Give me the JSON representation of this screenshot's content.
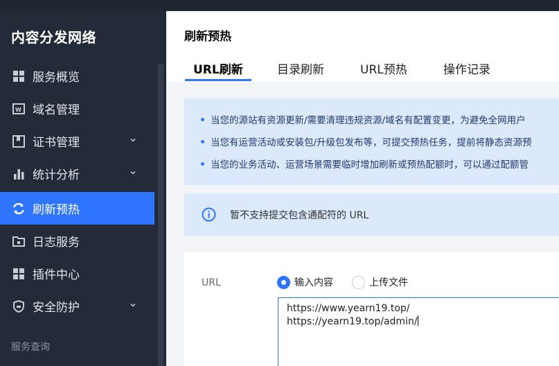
{
  "sidebar": {
    "title": "内容分发网络",
    "items": [
      {
        "label": "服务概览",
        "icon": "grid-icon",
        "expandable": false,
        "active": false
      },
      {
        "label": "域名管理",
        "icon": "domain-icon",
        "expandable": false,
        "active": false
      },
      {
        "label": "证书管理",
        "icon": "certificate-icon",
        "expandable": true,
        "active": false
      },
      {
        "label": "统计分析",
        "icon": "bar-chart-icon",
        "expandable": true,
        "active": false
      },
      {
        "label": "刷新预热",
        "icon": "refresh-icon",
        "expandable": false,
        "active": true
      },
      {
        "label": "日志服务",
        "icon": "folder-icon",
        "expandable": false,
        "active": false
      },
      {
        "label": "插件中心",
        "icon": "grid-icon",
        "expandable": false,
        "active": false
      },
      {
        "label": "安全防护",
        "icon": "shield-icon",
        "expandable": true,
        "active": false
      }
    ],
    "section_label": "服务查询"
  },
  "header": {
    "title": "刷新预热",
    "tabs": [
      {
        "label": "URL刷新",
        "active": true
      },
      {
        "label": "目录刷新",
        "active": false
      },
      {
        "label": "URL预热",
        "active": false
      },
      {
        "label": "操作记录",
        "active": false
      }
    ]
  },
  "tips": [
    "当您的源站有资源更新/需要清理违规资源/域名有配置变更，为避免全网用户",
    "当您有运营活动或安装包/升级包发布等，可提交预热任务，提前将静态资源预",
    "当您的业务活动、运营场景需要临时增加刷新或预热配额时，可以通过配额管"
  ],
  "notice": {
    "text": "暂不支持提交包含通配符的 URL"
  },
  "form": {
    "label": "URL",
    "radio_options": [
      {
        "label": "输入内容",
        "checked": true
      },
      {
        "label": "上传文件",
        "checked": false
      }
    ],
    "textarea_lines": [
      "https://www.yearn19.top/",
      "https://yearn19.top/admin/"
    ]
  },
  "colors": {
    "accent": "#2e74ff",
    "sidebar_bg": "#242b38",
    "tip_bg": "#dce8fc"
  }
}
